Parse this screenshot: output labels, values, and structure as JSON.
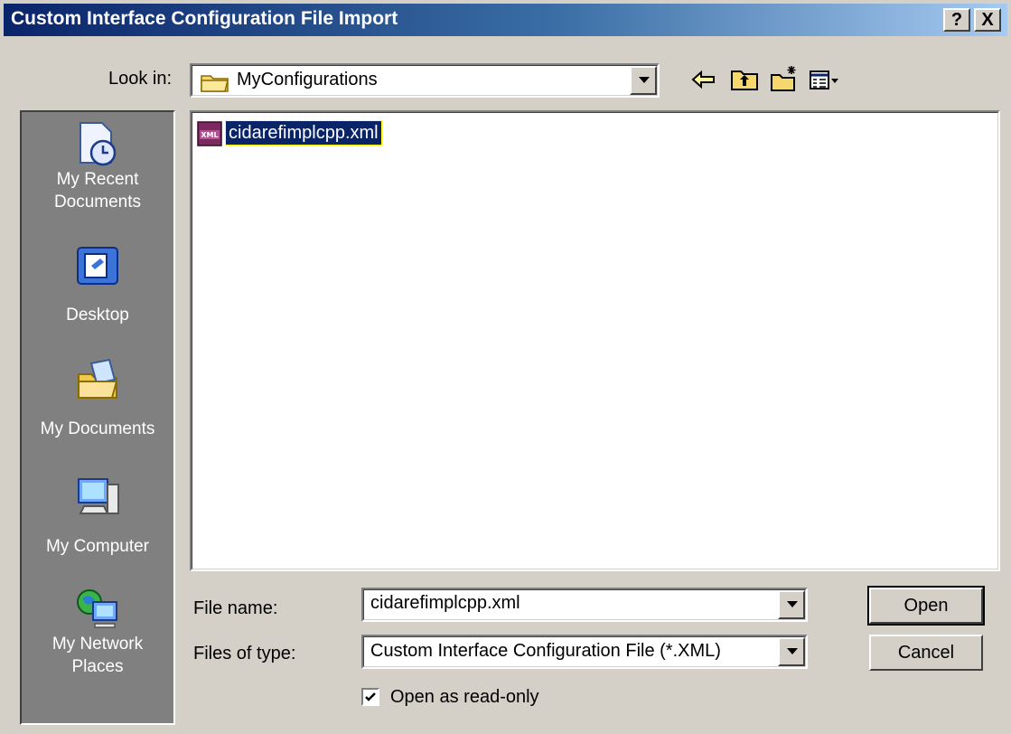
{
  "window": {
    "title": "Custom Interface Configuration File Import",
    "help_button": "?",
    "close_button": "X"
  },
  "look_in": {
    "label": "Look in:",
    "value": "MyConfigurations"
  },
  "toolbar": {
    "icons": [
      "back-arrow-icon",
      "up-folder-icon",
      "new-folder-icon",
      "view-menu-icon"
    ]
  },
  "places": [
    {
      "label_line1": "My Recent",
      "label_line2": "Documents",
      "icon": "recent-documents-icon"
    },
    {
      "label_line1": "Desktop",
      "label_line2": "",
      "icon": "desktop-icon"
    },
    {
      "label_line1": "My Documents",
      "label_line2": "",
      "icon": "my-documents-icon"
    },
    {
      "label_line1": "My Computer",
      "label_line2": "",
      "icon": "my-computer-icon"
    },
    {
      "label_line1": "My Network",
      "label_line2": "Places",
      "icon": "network-places-icon"
    }
  ],
  "files": [
    {
      "name": "cidarefimplcpp.xml",
      "icon": "xml-file-icon",
      "icon_text": "XML",
      "selected": true
    }
  ],
  "file_name": {
    "label": "File name:",
    "value": "cidarefimplcpp.xml"
  },
  "file_type": {
    "label": "Files of type:",
    "value": "Custom Interface Configuration File  (*.XML)"
  },
  "read_only": {
    "label": "Open as read-only",
    "checked": true
  },
  "buttons": {
    "open": "Open",
    "cancel": "Cancel"
  },
  "colors": {
    "titlebar_start": "#0a246a",
    "titlebar_end": "#a6caf0",
    "face": "#d4d0c8",
    "places_bg": "#808080",
    "selection": "#0a246a"
  }
}
